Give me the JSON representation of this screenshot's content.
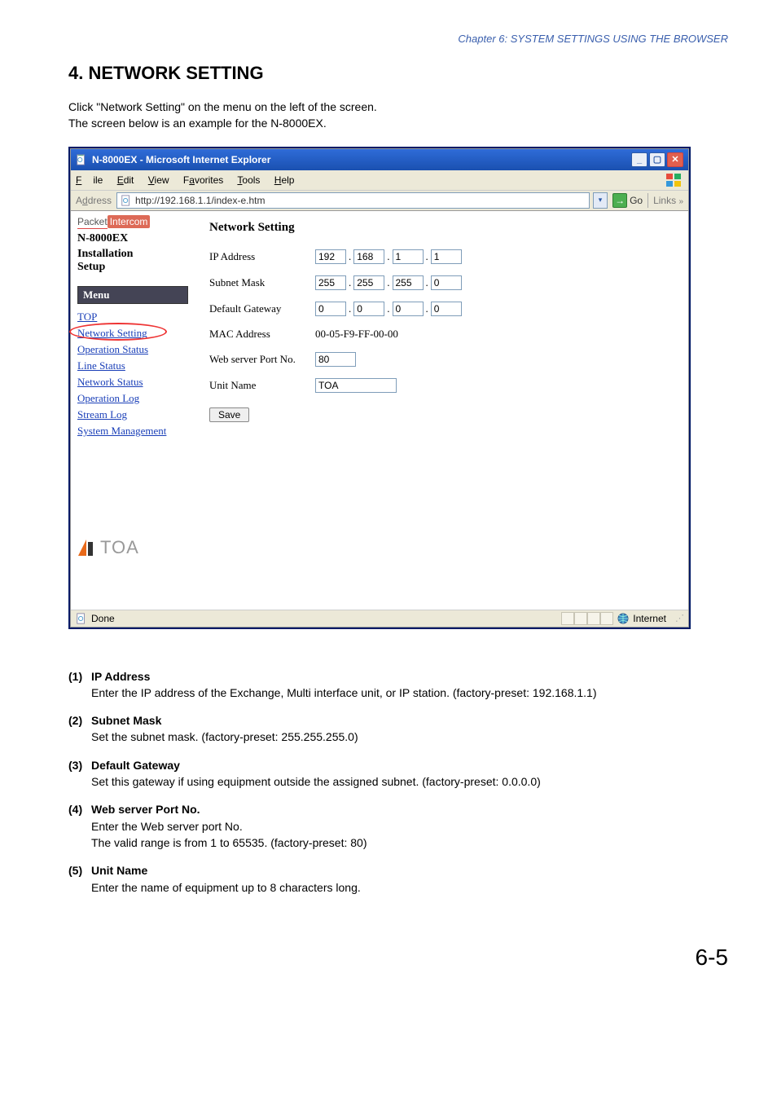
{
  "chapterHeader": "Chapter 6:  SYSTEM SETTINGS USING THE BROWSER",
  "sectionTitle": "4. NETWORK SETTING",
  "intro1": "Click \"Network Setting\" on the menu on the left of the screen.",
  "intro2": "The screen below is an example for the N-8000EX.",
  "ie": {
    "title": "N-8000EX - Microsoft Internet Explorer",
    "menu": {
      "file": "File",
      "edit": "Edit",
      "view": "View",
      "favorites": "Favorites",
      "tools": "Tools",
      "help": "Help"
    },
    "addressLabel": "Address",
    "url": "http://192.168.1.1/index-e.htm",
    "go": "Go",
    "links": "Links",
    "statusDone": "Done",
    "statusZone": "Internet"
  },
  "sidebar": {
    "brandPacket": "Packet",
    "brandIntercom": "Intercom",
    "n8000": "N-8000EX",
    "setup1": "Installation",
    "setup2": "Setup",
    "menuHeader": "Menu",
    "links": {
      "top": "TOP",
      "networkSetting": "Network Setting",
      "operationStatus": "Operation Status",
      "lineStatus": "Line Status",
      "networkStatus": "Network Status",
      "operationLog": "Operation Log",
      "streamLog": "Stream Log",
      "systemManagement": "System Management"
    },
    "toa": "TOA"
  },
  "form": {
    "title": "Network Setting",
    "ipLabel": "IP Address",
    "ip": [
      "192",
      "168",
      "1",
      "1"
    ],
    "subnetLabel": "Subnet Mask",
    "subnet": [
      "255",
      "255",
      "255",
      "0"
    ],
    "gatewayLabel": "Default Gateway",
    "gateway": [
      "0",
      "0",
      "0",
      "0"
    ],
    "macLabel": "MAC Address",
    "macValue": "00-05-F9-FF-00-00",
    "portLabel": "Web server Port No.",
    "portValue": "80",
    "unitLabel": "Unit Name",
    "unitValue": "TOA",
    "saveLabel": "Save"
  },
  "desc": {
    "items": [
      {
        "num": "(1)",
        "heading": "IP Address",
        "body": "Enter the IP address of the Exchange, Multi interface unit, or IP station. (factory-preset: 192.168.1.1)"
      },
      {
        "num": "(2)",
        "heading": "Subnet Mask",
        "body": "Set the subnet mask. (factory-preset: 255.255.255.0)"
      },
      {
        "num": "(3)",
        "heading": "Default Gateway",
        "body": "Set this gateway if using equipment outside the assigned subnet. (factory-preset: 0.0.0.0)"
      },
      {
        "num": "(4)",
        "heading": "Web server Port No.",
        "body": "Enter the Web server port No.\nThe valid range is from 1 to 65535. (factory-preset: 80)"
      },
      {
        "num": "(5)",
        "heading": "Unit Name",
        "body": "Enter the name of equipment up to 8 characters long."
      }
    ]
  },
  "pageNumber": "6-5"
}
